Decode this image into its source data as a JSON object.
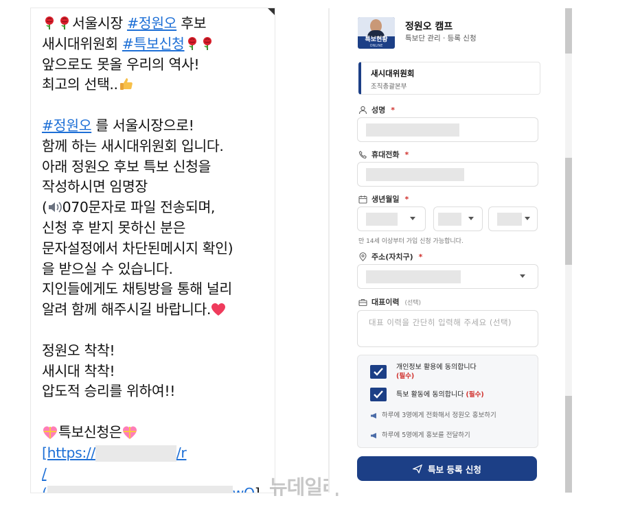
{
  "message": {
    "l1_text": "서울시장 ",
    "l1_tag": "#정원오",
    "l1_end": " 후보",
    "l2_text": "새시대위원회 ",
    "l2_tag": "#특보신청",
    "l3": "앞으로도 못올 우리의 역사!",
    "l4": "최고의 선택..",
    "l6_tag": "#정원오",
    "l6_end": " 를 서울시장으로!",
    "l7": "함께 하는 새시대위원회 입니다.",
    "l8": "아래 정원오 후보 특보 신청을",
    "l9": "작성하시면 임명장",
    "l10_open": "(",
    "l10": "070문자로 파일 전송되며,",
    "l11": "신청 후 받지 못하신 분은",
    "l12": "문자설정에서 차단된메시지 확인)",
    "l13": "을 받으실 수 있습니다.",
    "l14": "지인들에게도 채팅방을 통해 널리",
    "l15": "알려 함께 해주시길 바랍니다.",
    "l17": "정원오 착착!",
    "l18": "새시대 착착!",
    "l19": "압도적 승리를 위하여!!",
    "l21": "특보신청은",
    "link_a": "[https://",
    "link_b": "/r",
    "link_c": "/",
    "link_d": "(",
    "link_e": "wQ",
    "link_f": "]"
  },
  "watermark": "뉴데일리",
  "form": {
    "logo_text": "특보현황",
    "logo_sub": "ONLINE",
    "title": "정원오 캠프",
    "subtitle": "특보단 관리 · 등록 신청",
    "org_title": "새시대위원회",
    "org_sub": "조직총괄본부",
    "name_label": "성명",
    "phone_label": "휴대전화",
    "birth_label": "생년월일",
    "birth_hint": "만 14세 이상부터 가입 신청 가능합니다.",
    "address_label": "주소(자치구)",
    "career_label": "대표이력",
    "career_optional": "(선택)",
    "career_placeholder": "대표 이력을 간단히 입력해 주세요 (선택)",
    "required_mark": "*",
    "agree1_label": "개인정보 활용에 동의합니다",
    "agree1_req": "(필수)",
    "agree2_label": "특보 활동에 동의합니다",
    "agree2_req": "(필수)",
    "note1": "하루에 3명에게 전화해서 정원오 홍보하기",
    "note2": "하루에 5명에게 홍보를 전달하기",
    "submit_label": "특보 등록 신청",
    "agree1_checked": true,
    "agree2_checked": true
  },
  "icons": [
    "rose-icon",
    "thumbs-up-icon",
    "speaker-icon",
    "heart-icon",
    "gift-heart-icon",
    "person-icon",
    "phone-icon",
    "calendar-icon",
    "pin-icon",
    "briefcase-icon",
    "megaphone-icon",
    "send-icon",
    "check-icon",
    "chevron-down-icon"
  ],
  "colors": {
    "link": "#1d6fd6",
    "brand": "#1c3f86",
    "required": "#d0312d"
  }
}
